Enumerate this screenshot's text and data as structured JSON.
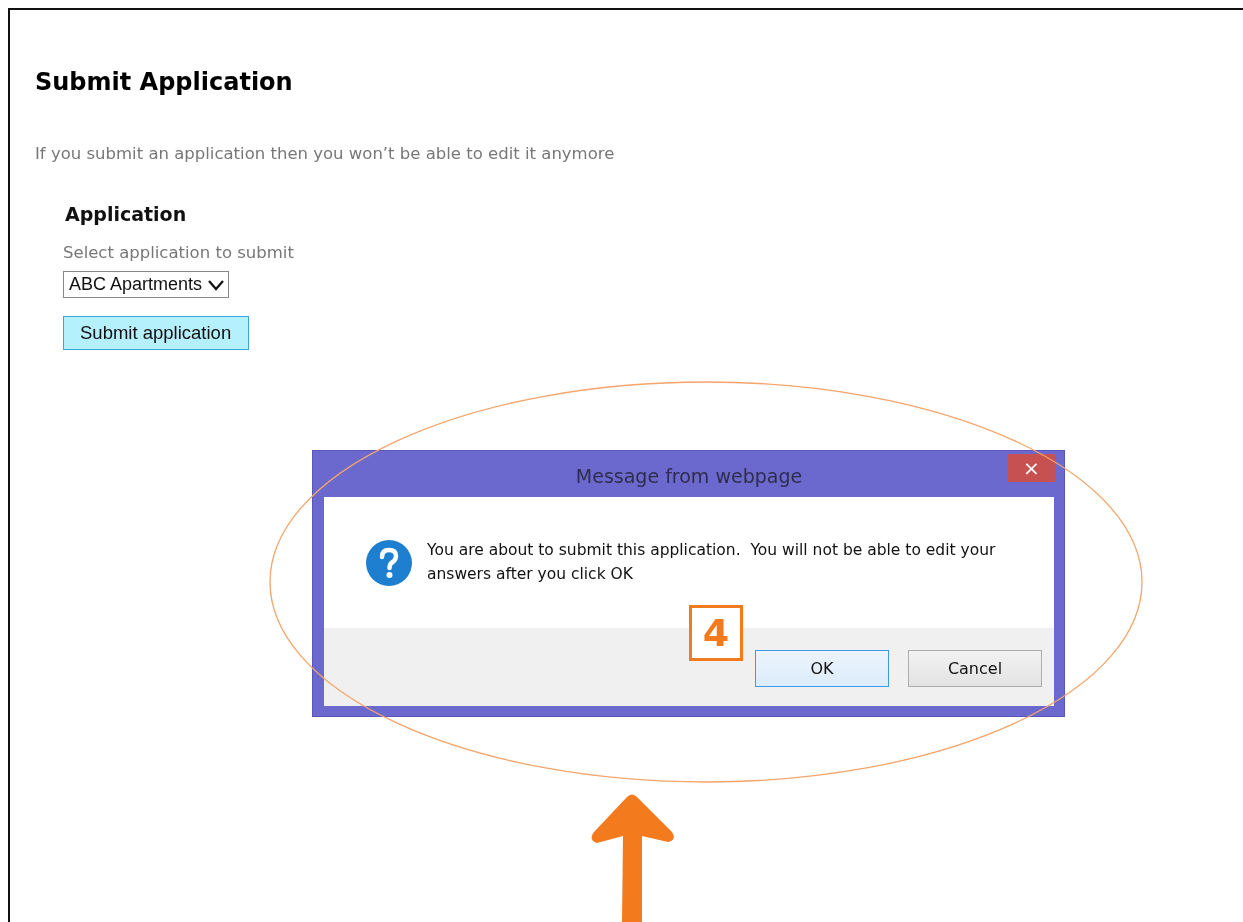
{
  "page": {
    "title": "Submit Application",
    "notice": "If you submit an application then you won’t be able to edit it anymore",
    "section": {
      "heading": "Application",
      "label": "Select application to submit",
      "select_value": "ABC Apartments",
      "submit_button": "Submit application"
    }
  },
  "dialog": {
    "title": "Message from webpage",
    "close": "×",
    "message": "You are about to submit this application.  You will not be able to edit your answers after you click OK",
    "buttons": [
      {
        "label": "OK",
        "selected": true
      },
      {
        "label": "Cancel",
        "selected": false
      }
    ]
  },
  "annotation": {
    "step": "4"
  }
}
